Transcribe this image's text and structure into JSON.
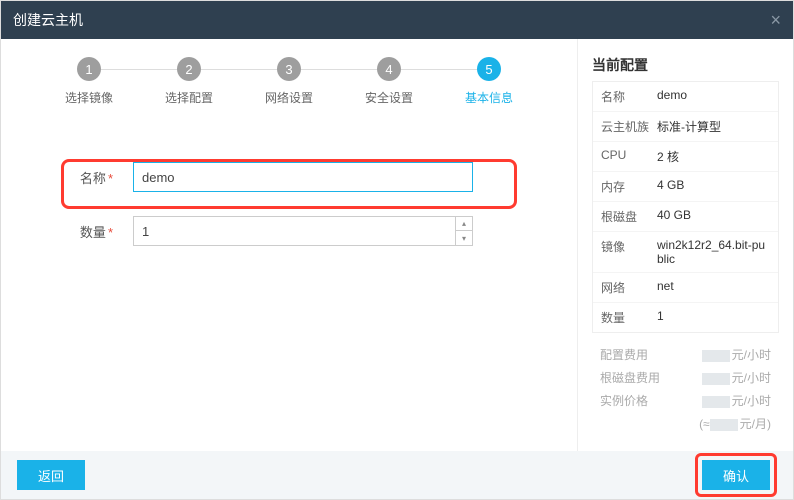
{
  "header": {
    "title": "创建云主机"
  },
  "steps": [
    {
      "num": "1",
      "label": "选择镜像"
    },
    {
      "num": "2",
      "label": "选择配置"
    },
    {
      "num": "3",
      "label": "网络设置"
    },
    {
      "num": "4",
      "label": "安全设置"
    },
    {
      "num": "5",
      "label": "基本信息"
    }
  ],
  "form": {
    "name_label": "名称",
    "name_value": "demo",
    "qty_label": "数量",
    "qty_value": "1"
  },
  "side": {
    "title": "当前配置",
    "rows": [
      {
        "k": "名称",
        "v": "demo"
      },
      {
        "k": "云主机族",
        "v": "标准-计算型"
      },
      {
        "k": "CPU",
        "v": "2 核"
      },
      {
        "k": "内存",
        "v": "4 GB"
      },
      {
        "k": "根磁盘",
        "v": "40 GB"
      },
      {
        "k": "镜像",
        "v": "win2k12r2_64.bit-public"
      },
      {
        "k": "网络",
        "v": "net"
      },
      {
        "k": "数量",
        "v": "1"
      }
    ],
    "cost": {
      "config_label": "配置费用",
      "disk_label": "根磁盘费用",
      "price_label": "实例价格",
      "unit_hour": "元/小时",
      "unit_month": "元/月)",
      "approx_prefix": "(≈"
    }
  },
  "footer": {
    "back": "返回",
    "ok": "确认"
  }
}
